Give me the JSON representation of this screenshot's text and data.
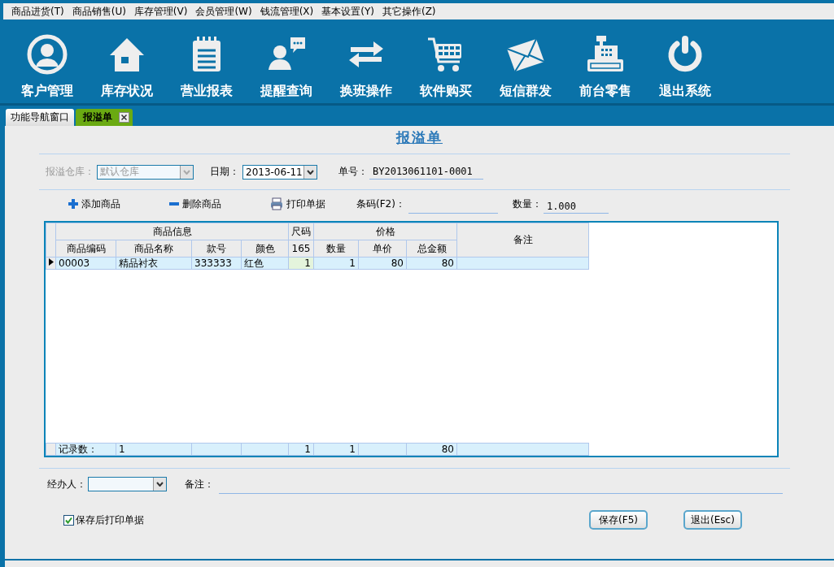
{
  "menu": [
    {
      "label": "商品进货(T)"
    },
    {
      "label": "商品销售(U)"
    },
    {
      "label": "库存管理(V)"
    },
    {
      "label": "会员管理(W)"
    },
    {
      "label": "钱流管理(X)"
    },
    {
      "label": "基本设置(Y)"
    },
    {
      "label": "其它操作(Z)"
    }
  ],
  "toolbar": [
    {
      "label": "客户管理"
    },
    {
      "label": "库存状况"
    },
    {
      "label": "营业报表"
    },
    {
      "label": "提醒查询"
    },
    {
      "label": "换班操作"
    },
    {
      "label": "软件购买"
    },
    {
      "label": "短信群发"
    },
    {
      "label": "前台零售"
    },
    {
      "label": "退出系统"
    }
  ],
  "tabs": [
    {
      "label": "功能导航窗口",
      "selected": false,
      "closable": false
    },
    {
      "label": "报溢单",
      "selected": true,
      "closable": true
    }
  ],
  "form": {
    "title": "报溢单",
    "warehouse": {
      "label": "报溢仓库：",
      "value": "默认仓库",
      "disabled": true
    },
    "date": {
      "label": "日期：",
      "value": "2013-06-11"
    },
    "order_no": {
      "label": "单号：",
      "value": "BY2013061101-0001"
    },
    "actions": [
      {
        "label": "添加商品"
      },
      {
        "label": "删除商品"
      },
      {
        "label": "打印单据"
      }
    ],
    "barcode": {
      "label": "条码(F2)："
    },
    "quantity": {
      "label": "数量：",
      "value": "1.000"
    }
  },
  "table": {
    "group_headers": {
      "info": "商品信息",
      "size": "尺码",
      "price": "价格",
      "remark": "备注"
    },
    "columns": {
      "code": "商品编码",
      "name": "商品名称",
      "style": "款号",
      "color_name": "颜色",
      "size": "165",
      "qty": "数量",
      "price": "单价",
      "amount": "总金额"
    },
    "rows": [
      {
        "current": true,
        "code": "00003",
        "name": "精品衬衣",
        "style": "333333",
        "color_name": "红色",
        "size": "1",
        "qty": "1",
        "price": "80",
        "amount": "80"
      }
    ],
    "footer": {
      "label": "记录数：",
      "count": "1",
      "size": "1",
      "qty": "1",
      "amount": "80"
    }
  },
  "handler": {
    "label": "经办人："
  },
  "remark": {
    "label": "备注："
  },
  "print_after_save": {
    "label": "保存后打印单据",
    "checked": true
  },
  "buttons": [
    {
      "label": "保存(F5)"
    },
    {
      "label": "退出(Esc)"
    }
  ]
}
